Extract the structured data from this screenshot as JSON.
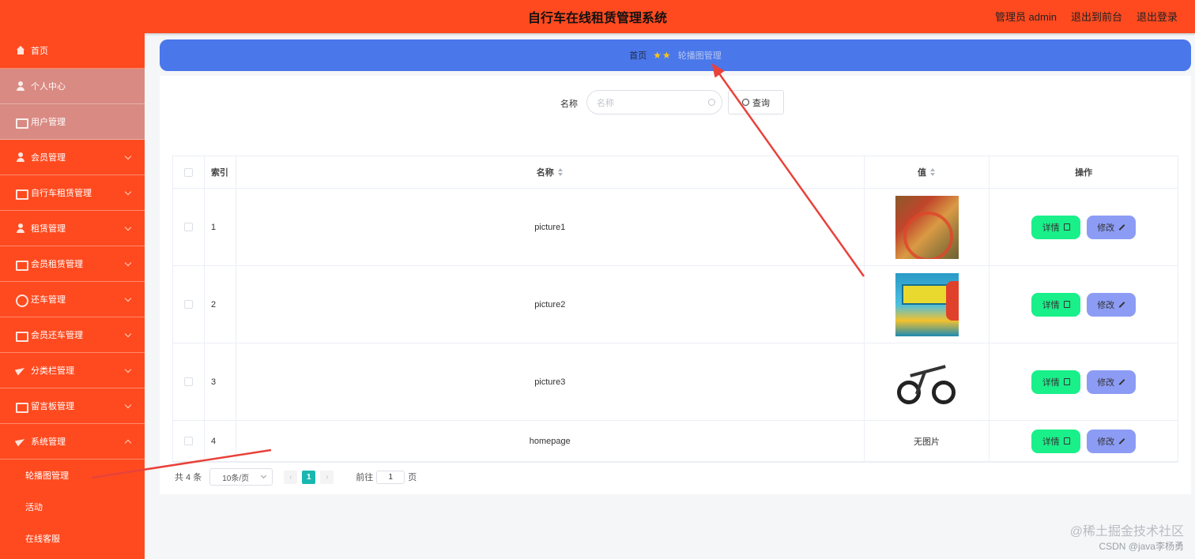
{
  "header": {
    "title": "自行车在线租赁管理系统",
    "admin": "管理员 admin",
    "to_front": "退出到前台",
    "logout": "退出登录"
  },
  "sidebar": {
    "items": [
      {
        "label": "首页",
        "icon": "home-icon"
      },
      {
        "label": "个人中心",
        "icon": "person-icon"
      },
      {
        "label": "用户管理",
        "icon": "grid-icon"
      },
      {
        "label": "会员管理",
        "icon": "person-icon"
      },
      {
        "label": "自行车租赁管理",
        "icon": "bike-icon"
      },
      {
        "label": "租赁管理",
        "icon": "person-icon"
      },
      {
        "label": "会员租赁管理",
        "icon": "list-icon"
      },
      {
        "label": "还车管理",
        "icon": "clock-icon"
      },
      {
        "label": "会员还车管理",
        "icon": "card-icon"
      },
      {
        "label": "分类栏管理",
        "icon": "send-icon"
      },
      {
        "label": "留言板管理",
        "icon": "chart-icon"
      },
      {
        "label": "系统管理",
        "icon": "plane-icon"
      }
    ],
    "sub_items": [
      {
        "label": "轮播图管理"
      },
      {
        "label": "活动"
      },
      {
        "label": "在线客服"
      }
    ]
  },
  "breadcrumb": {
    "home": "首页",
    "stars": "★★",
    "current": "轮播图管理"
  },
  "search": {
    "label": "名称",
    "placeholder": "名称",
    "button": "查询"
  },
  "table": {
    "headers": {
      "index": "索引",
      "name": "名称",
      "value": "值",
      "ops": "操作"
    },
    "rows": [
      {
        "index": "1",
        "name": "picture1",
        "value": ""
      },
      {
        "index": "2",
        "name": "picture2",
        "value": ""
      },
      {
        "index": "3",
        "name": "picture3",
        "value": ""
      },
      {
        "index": "4",
        "name": "homepage",
        "value": "无图片"
      }
    ],
    "detail_label": "详情",
    "edit_label": "修改"
  },
  "pagination": {
    "total": "共 4 条",
    "page_size": "10条/页",
    "prev": "‹",
    "current": "1",
    "next": "›",
    "goto_label": "前往",
    "goto_value": "1",
    "page_unit": "页"
  },
  "watermark": {
    "line1": "@稀土掘金技术社区",
    "line2": "CSDN @java李杨勇"
  },
  "colors": {
    "primary": "#ff4a1f",
    "breadcrumb_bg": "#4a77ea",
    "detail_btn": "#19f08a",
    "edit_btn": "#8c9cf5",
    "page_active": "#19b7b0",
    "annotation": "#e8423b"
  }
}
